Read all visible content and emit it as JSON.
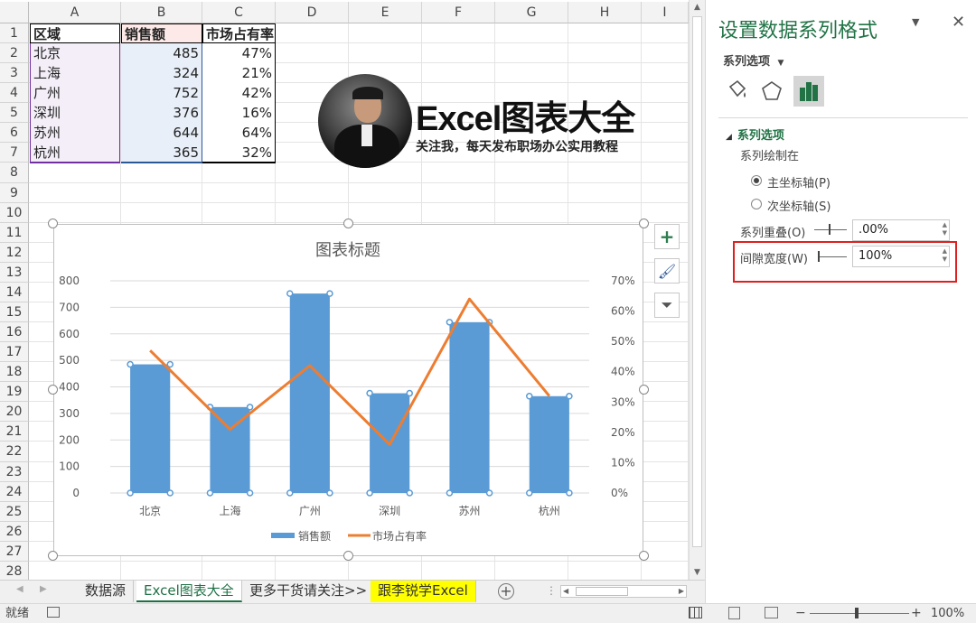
{
  "columns": [
    "A",
    "B",
    "C",
    "D",
    "E",
    "F",
    "G",
    "H",
    "I"
  ],
  "rows": [
    "1",
    "2",
    "3",
    "4",
    "5",
    "6",
    "7",
    "8",
    "9",
    "10",
    "11",
    "12",
    "13",
    "14",
    "15",
    "16",
    "17",
    "18",
    "19",
    "20",
    "21",
    "22",
    "23",
    "24",
    "25",
    "26",
    "27",
    "28"
  ],
  "table": {
    "headers": [
      "区域",
      "销售额",
      "市场占有率"
    ],
    "rows": [
      [
        "北京",
        "485",
        "47%"
      ],
      [
        "上海",
        "324",
        "21%"
      ],
      [
        "广州",
        "752",
        "42%"
      ],
      [
        "深圳",
        "376",
        "16%"
      ],
      [
        "苏州",
        "644",
        "64%"
      ],
      [
        "杭州",
        "365",
        "32%"
      ]
    ]
  },
  "banner": {
    "title": "Excel图表大全",
    "subtitle": "关注我，每天发布职场办公实用教程"
  },
  "chart_data": {
    "type": "bar",
    "title": "图表标题",
    "categories": [
      "北京",
      "上海",
      "广州",
      "深圳",
      "苏州",
      "杭州"
    ],
    "series": [
      {
        "name": "销售额",
        "kind": "bar",
        "axis": "primary",
        "values": [
          485,
          324,
          752,
          376,
          644,
          365
        ],
        "color": "#5b9bd5"
      },
      {
        "name": "市场占有率",
        "kind": "line",
        "axis": "secondary",
        "values": [
          0.47,
          0.21,
          0.42,
          0.16,
          0.64,
          0.32
        ],
        "color": "#ed7d31"
      }
    ],
    "ylim": [
      0,
      800
    ],
    "y_ticks": [
      "0",
      "100",
      "200",
      "300",
      "400",
      "500",
      "600",
      "700",
      "800"
    ],
    "y2lim": [
      0,
      0.7
    ],
    "y2_ticks": [
      "0%",
      "10%",
      "20%",
      "30%",
      "40%",
      "50%",
      "60%",
      "70%"
    ],
    "grid": true,
    "legend": "bottom"
  },
  "chart_tools": {
    "add": "+",
    "style": "🖌",
    "filter": "⏷"
  },
  "sheet_tabs": [
    "数据源",
    "Excel图表大全",
    "更多干货请关注>>",
    "跟李锐学Excel"
  ],
  "status": {
    "ready": "就绪",
    "zoom": "100%"
  },
  "pane": {
    "title": "设置数据系列格式",
    "series_options_menu": "系列选项",
    "section": "系列选项",
    "plot_on": "系列绘制在",
    "primary_axis": "主坐标轴(P)",
    "secondary_axis": "次坐标轴(S)",
    "overlap_label": "系列重叠(O)",
    "overlap_value": ".00%",
    "gap_label": "间隙宽度(W)",
    "gap_value": "100%"
  },
  "colors": {
    "accent": "#217346",
    "bar": "#5b9bd5",
    "line": "#ed7d31",
    "highlight": "#e02020"
  }
}
